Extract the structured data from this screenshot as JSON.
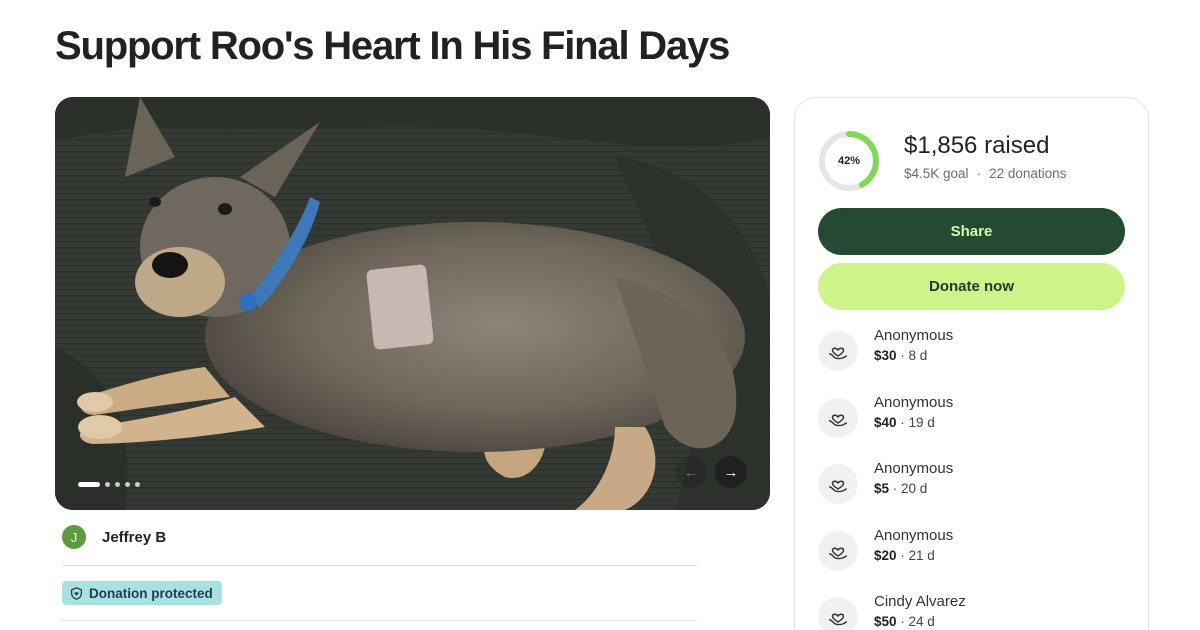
{
  "title": "Support Roo's Heart In His Final Days",
  "gallery": {
    "total_slides": 5,
    "active_slide": 1,
    "prev_arrow": "←",
    "next_arrow": "→"
  },
  "organizer": {
    "initial": "J",
    "name": "Jeffrey B"
  },
  "badge": {
    "label": "Donation protected"
  },
  "progress": {
    "percent_label": "42%",
    "fraction": 0.42,
    "raised": "$1,856 raised",
    "goal": "$4.5K goal",
    "separator": "·",
    "donations": "22 donations"
  },
  "buttons": {
    "share": "Share",
    "donate": "Donate now"
  },
  "donations": [
    {
      "name": "Anonymous",
      "amount": "$30",
      "age": "· 8 d"
    },
    {
      "name": "Anonymous",
      "amount": "$40",
      "age": "· 19 d"
    },
    {
      "name": "Anonymous",
      "amount": "$5",
      "age": "· 20 d"
    },
    {
      "name": "Anonymous",
      "amount": "$20",
      "age": "· 21 d"
    },
    {
      "name": "Cindy Alvarez",
      "amount": "$50",
      "age": "· 24 d"
    }
  ],
  "colors": {
    "progress_ring": "#7ed957",
    "progress_track": "#e6e6e6",
    "share_bg": "#254a32",
    "donate_bg": "#cdf58a",
    "badge_bg": "#a8e1e0",
    "avatar_bg": "#5e9b3c"
  },
  "icons": {
    "donation": "heart-hand-icon",
    "badge": "shield-icon"
  }
}
